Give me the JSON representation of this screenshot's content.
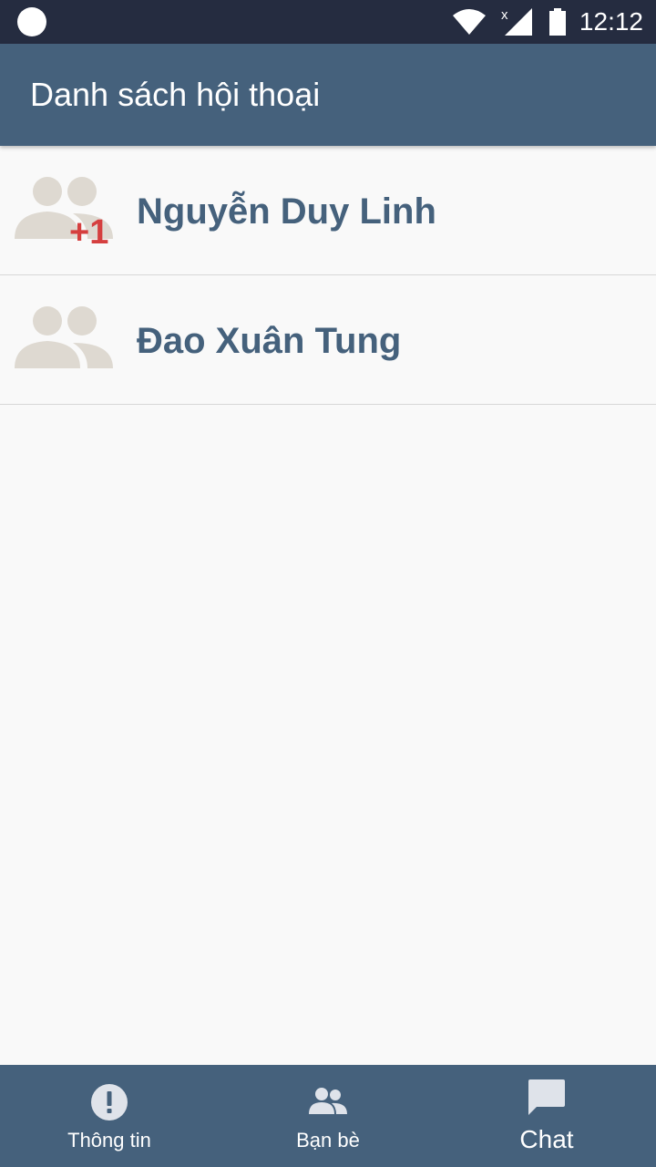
{
  "status_bar": {
    "time": "12:12",
    "icons": [
      "circle-notification-icon",
      "wifi-icon",
      "cellular-no-data-icon",
      "battery-icon"
    ]
  },
  "app_bar": {
    "title": "Danh sách hội thoại"
  },
  "conversations": [
    {
      "name": "Nguyễn Duy Linh",
      "icon": "group-avatar-icon",
      "badge": "+1"
    },
    {
      "name": "Đao Xuân Tung",
      "icon": "group-avatar-icon"
    }
  ],
  "bottom_nav": {
    "items": [
      {
        "label": "Thông tin",
        "icon": "info-alert-icon"
      },
      {
        "label": "Bạn bè",
        "icon": "friends-icon"
      },
      {
        "label": "Chat",
        "icon": "chat-bubble-icon",
        "active": true
      }
    ]
  },
  "colors": {
    "status_bar": "#252c40",
    "primary": "#45617c",
    "background": "#f9f9f9",
    "avatar": "#ded9d1",
    "badge": "#d53f3f",
    "nav_icon": "#dfe3ea"
  }
}
